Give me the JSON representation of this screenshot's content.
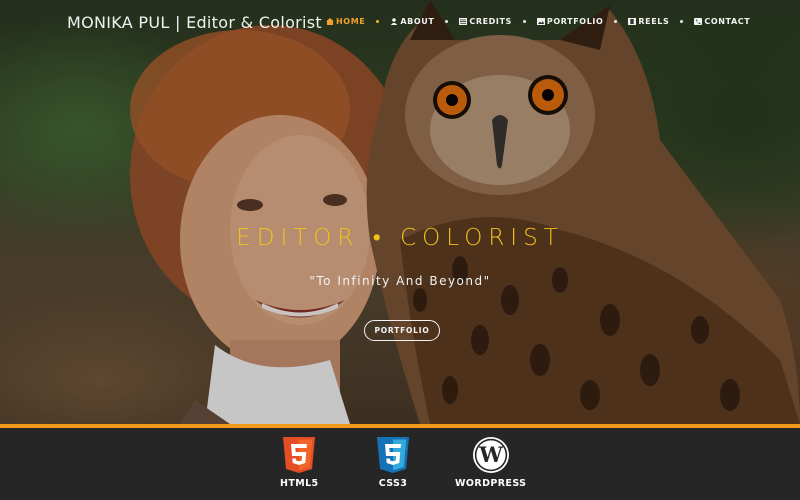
{
  "header": {
    "brand": "MONIKA PUL | Editor & Colorist",
    "nav": [
      {
        "label": "HOME",
        "icon": "home-icon",
        "active": true
      },
      {
        "label": "ABOUT",
        "icon": "user-icon",
        "active": false
      },
      {
        "label": "CREDITS",
        "icon": "list-icon",
        "active": false
      },
      {
        "label": "PORTFOLIO",
        "icon": "image-icon",
        "active": false
      },
      {
        "label": "REELS",
        "icon": "film-icon",
        "active": false
      },
      {
        "label": "CONTACT",
        "icon": "phone-icon",
        "active": false
      }
    ]
  },
  "hero": {
    "tagline": "EDITOR • COLORIST",
    "quote": "\"To Infinity And Beyond\"",
    "button_label": "PORTFOLIO"
  },
  "tech": {
    "items": [
      {
        "label": "HTML5",
        "icon": "html5-icon"
      },
      {
        "label": "CSS3",
        "icon": "css3-icon"
      },
      {
        "label": "WORDPRESS",
        "icon": "wordpress-icon"
      }
    ]
  },
  "colors": {
    "accent": "#f39a1c",
    "tagline": "#f3c21a",
    "nav_active": "#f0a030",
    "footer_bg": "#262626"
  }
}
